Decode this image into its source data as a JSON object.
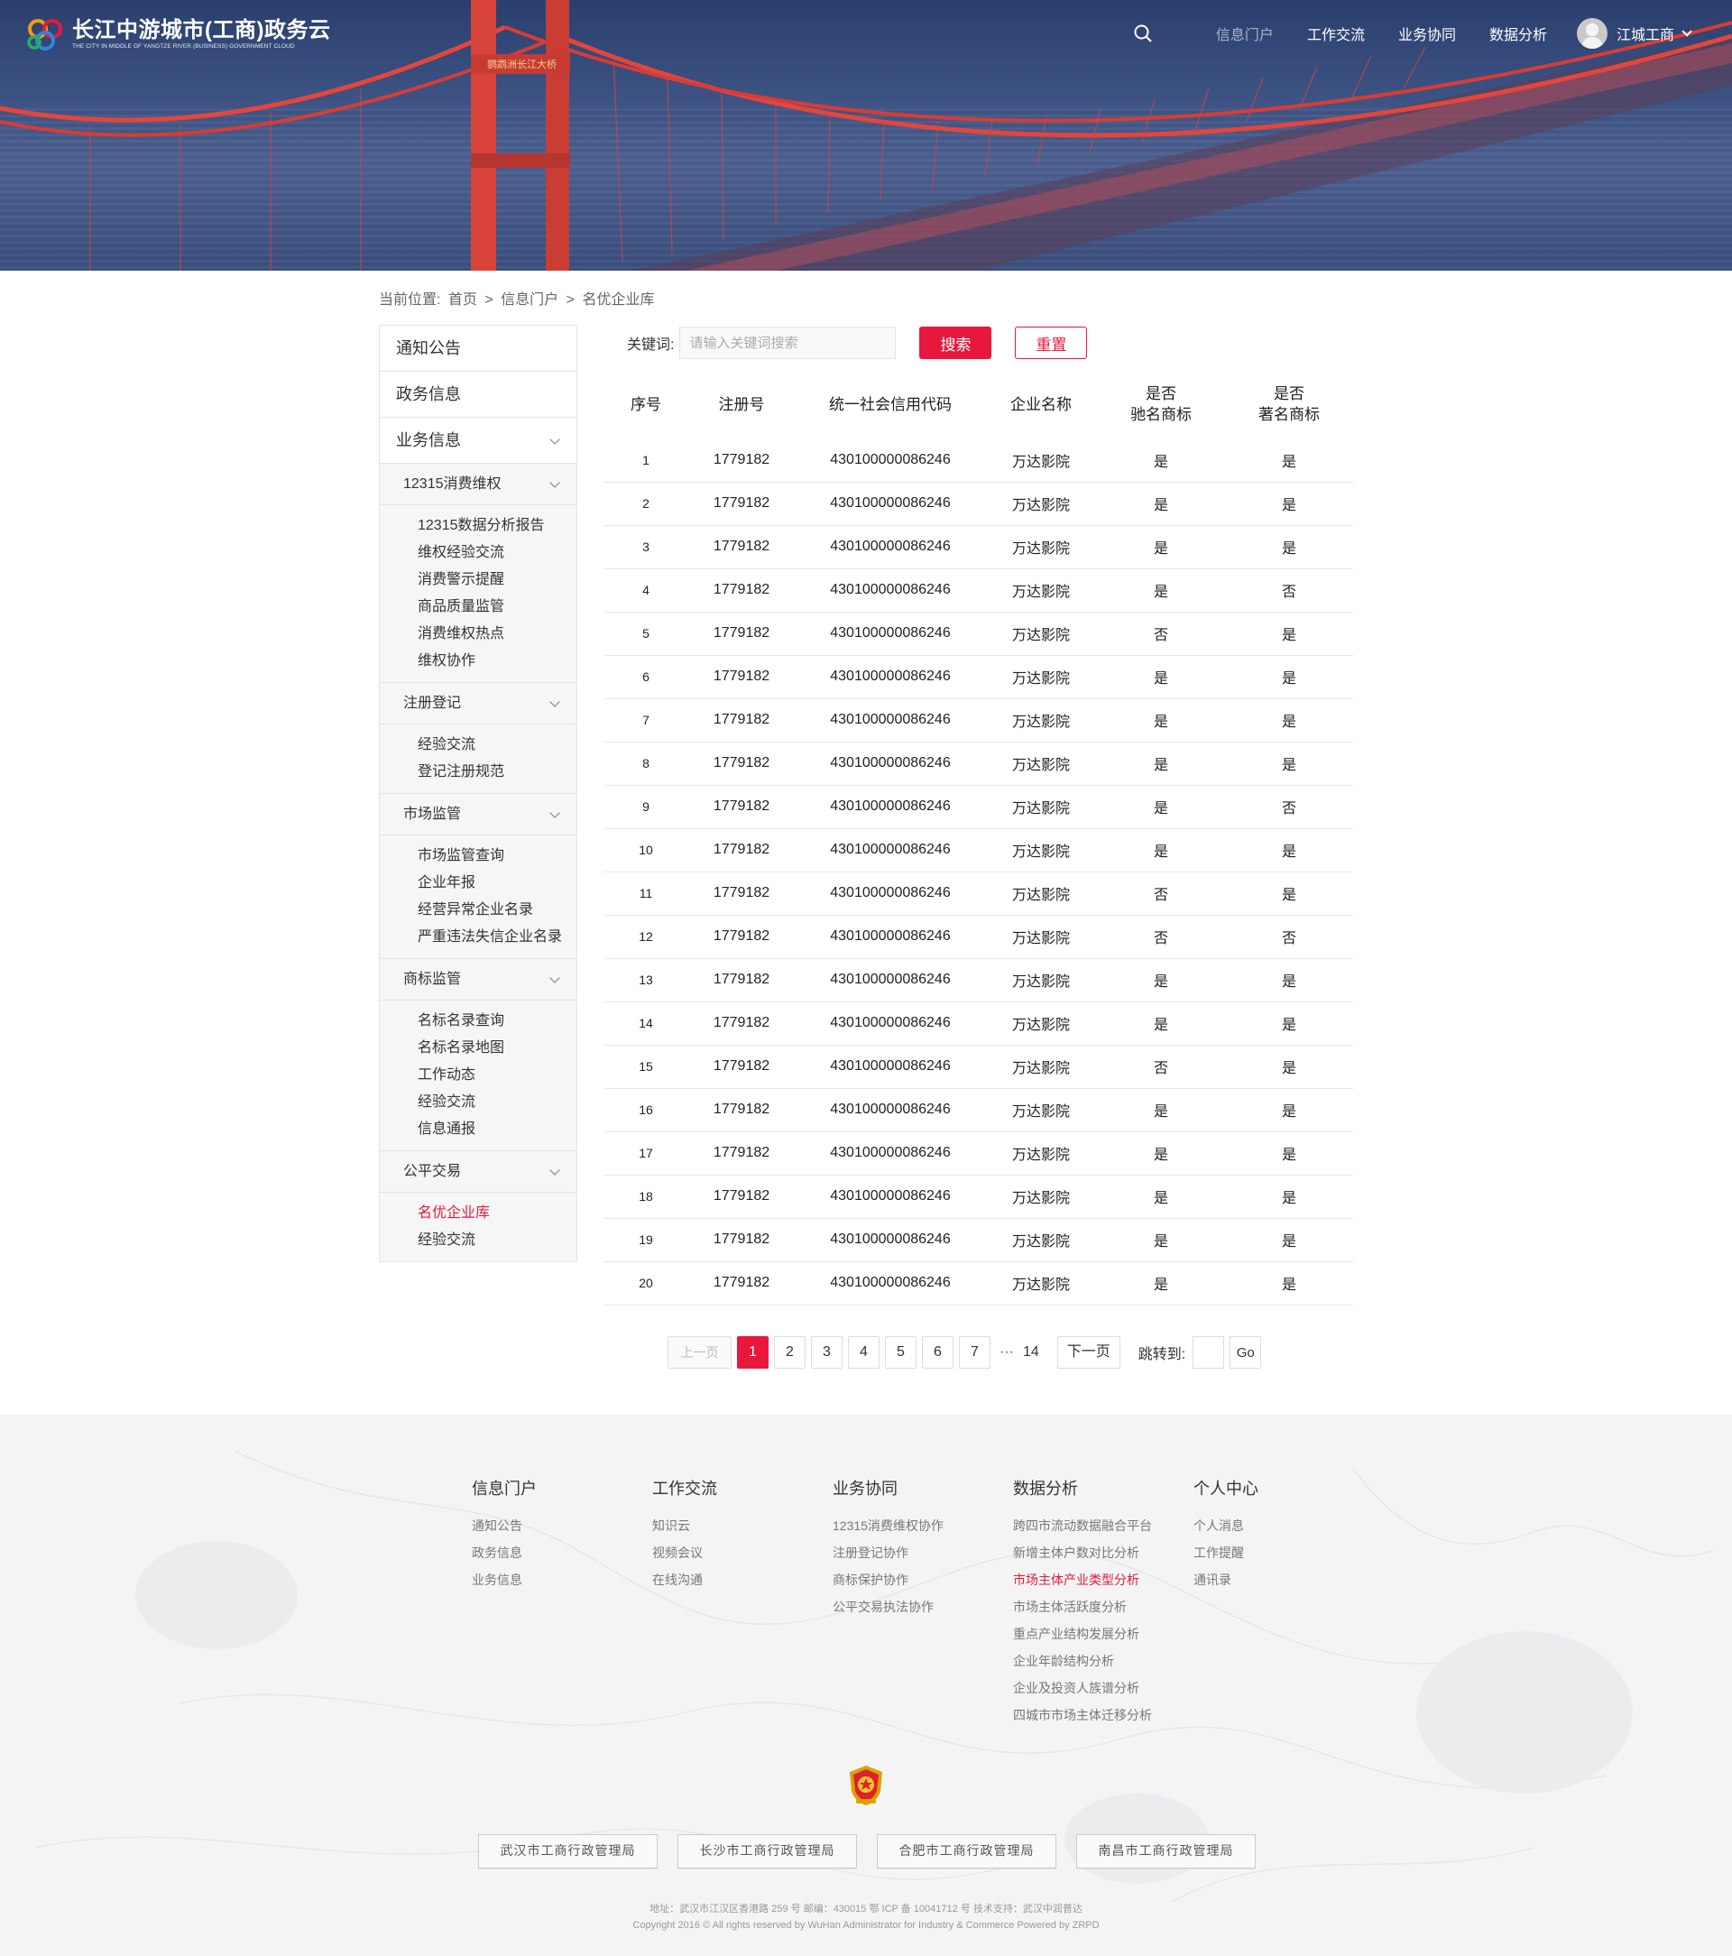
{
  "header": {
    "logo_cn": "长江中游城市(工商)政务云",
    "logo_en": "THE CITY IN MIDDLE OF YANGTZE RIVER (BUSINESS) GOVERNMENT CLOUD",
    "nav": [
      "信息门户",
      "工作交流",
      "业务协同",
      "数据分析"
    ],
    "active_nav": "信息门户",
    "user_name": "江城工商",
    "search_icon": "search-icon",
    "user_caret_icon": "chevron-down-icon"
  },
  "breadcrumb": {
    "label": "当前位置:",
    "items": [
      "首页",
      ">",
      "信息门户",
      ">",
      "名优企业库"
    ]
  },
  "sidebar": {
    "top_items": [
      "通知公告",
      "政务信息",
      "业务信息"
    ],
    "sections": [
      {
        "title": "12315消费维权",
        "items": [
          "12315数据分析报告",
          "维权经验交流",
          "消费警示提醒",
          "商品质量监管",
          "消费维权热点",
          "维权协作"
        ]
      },
      {
        "title": "注册登记",
        "items": [
          "经验交流",
          "登记注册规范"
        ]
      },
      {
        "title": "市场监管",
        "items": [
          "市场监管查询",
          "企业年报",
          "经营异常企业名录",
          "严重违法失信企业名录"
        ]
      },
      {
        "title": "商标监管",
        "items": [
          "名标名录查询",
          "名标名录地图",
          "工作动态",
          "经验交流",
          "信息通报"
        ]
      },
      {
        "title": "公平交易",
        "items": [
          "名优企业库",
          "经验交流"
        ]
      }
    ],
    "active_item": "名优企业库",
    "accent_color": "#e8183c"
  },
  "search": {
    "label": "关键词:",
    "placeholder": "请输入关键词搜索",
    "search_button": "搜索",
    "reset_button": "重置"
  },
  "table": {
    "headers": [
      "序号",
      "注册号",
      "统一社会信用代码",
      "企业名称",
      "是否\n驰名商标",
      "是否\n著名商标"
    ],
    "rows": [
      [
        "1",
        "1779182",
        "430100000086246",
        "万达影院",
        "是",
        "是"
      ],
      [
        "2",
        "1779182",
        "430100000086246",
        "万达影院",
        "是",
        "是"
      ],
      [
        "3",
        "1779182",
        "430100000086246",
        "万达影院",
        "是",
        "是"
      ],
      [
        "4",
        "1779182",
        "430100000086246",
        "万达影院",
        "是",
        "否"
      ],
      [
        "5",
        "1779182",
        "430100000086246",
        "万达影院",
        "否",
        "是"
      ],
      [
        "6",
        "1779182",
        "430100000086246",
        "万达影院",
        "是",
        "是"
      ],
      [
        "7",
        "1779182",
        "430100000086246",
        "万达影院",
        "是",
        "是"
      ],
      [
        "8",
        "1779182",
        "430100000086246",
        "万达影院",
        "是",
        "是"
      ],
      [
        "9",
        "1779182",
        "430100000086246",
        "万达影院",
        "是",
        "否"
      ],
      [
        "10",
        "1779182",
        "430100000086246",
        "万达影院",
        "是",
        "是"
      ],
      [
        "11",
        "1779182",
        "430100000086246",
        "万达影院",
        "否",
        "是"
      ],
      [
        "12",
        "1779182",
        "430100000086246",
        "万达影院",
        "否",
        "否"
      ],
      [
        "13",
        "1779182",
        "430100000086246",
        "万达影院",
        "是",
        "是"
      ],
      [
        "14",
        "1779182",
        "430100000086246",
        "万达影院",
        "是",
        "是"
      ],
      [
        "15",
        "1779182",
        "430100000086246",
        "万达影院",
        "否",
        "是"
      ],
      [
        "16",
        "1779182",
        "430100000086246",
        "万达影院",
        "是",
        "是"
      ],
      [
        "17",
        "1779182",
        "430100000086246",
        "万达影院",
        "是",
        "是"
      ],
      [
        "18",
        "1779182",
        "430100000086246",
        "万达影院",
        "是",
        "是"
      ],
      [
        "19",
        "1779182",
        "430100000086246",
        "万达影院",
        "是",
        "是"
      ],
      [
        "20",
        "1779182",
        "430100000086246",
        "万达影院",
        "是",
        "是"
      ]
    ]
  },
  "pagination": {
    "prev": "上一页",
    "pages": [
      "1",
      "2",
      "3",
      "4",
      "5",
      "6",
      "7"
    ],
    "current": "1",
    "ellipsis": "···",
    "last": "14",
    "next": "下一页",
    "jump_label": "跳转到:",
    "go": "Go"
  },
  "footer": {
    "columns": [
      {
        "title": "信息门户",
        "items": [
          "通知公告",
          "政务信息",
          "业务信息"
        ]
      },
      {
        "title": "工作交流",
        "items": [
          "知识云",
          "视频会议",
          "在线沟通"
        ]
      },
      {
        "title": "业务协同",
        "items": [
          "12315消费维权协作",
          "注册登记协作",
          "商标保护协作",
          "公平交易执法协作"
        ]
      },
      {
        "title": "数据分析",
        "items": [
          "跨四市流动数据融合平台",
          "新增主体户数对比分析",
          "市场主体产业类型分析",
          "市场主体活跃度分析",
          "重点产业结构发展分析",
          "企业年龄结构分析",
          "企业及投资人族谱分析",
          "四城市市场主体迁移分析"
        ]
      },
      {
        "title": "个人中心",
        "items": [
          "个人消息",
          "工作提醒",
          "通讯录"
        ]
      }
    ],
    "active_item": "市场主体产业类型分析",
    "emblem_icon": "national-emblem-icon",
    "bureaus": [
      "武汉市工商行政管理局",
      "长沙市工商行政管理局",
      "合肥市工商行政管理局",
      "南昌市工商行政管理局"
    ],
    "address_line": "地址：武汉市江汉区香港路 259 号   邮编：430015   鄂 ICP 备 10041712 号   技术支持：武汉中润普达",
    "copyright_line": "Copyright 2016 © All rights reserved by WuHan Administrator for Industry & Commerce   Powered by ZRPD"
  }
}
